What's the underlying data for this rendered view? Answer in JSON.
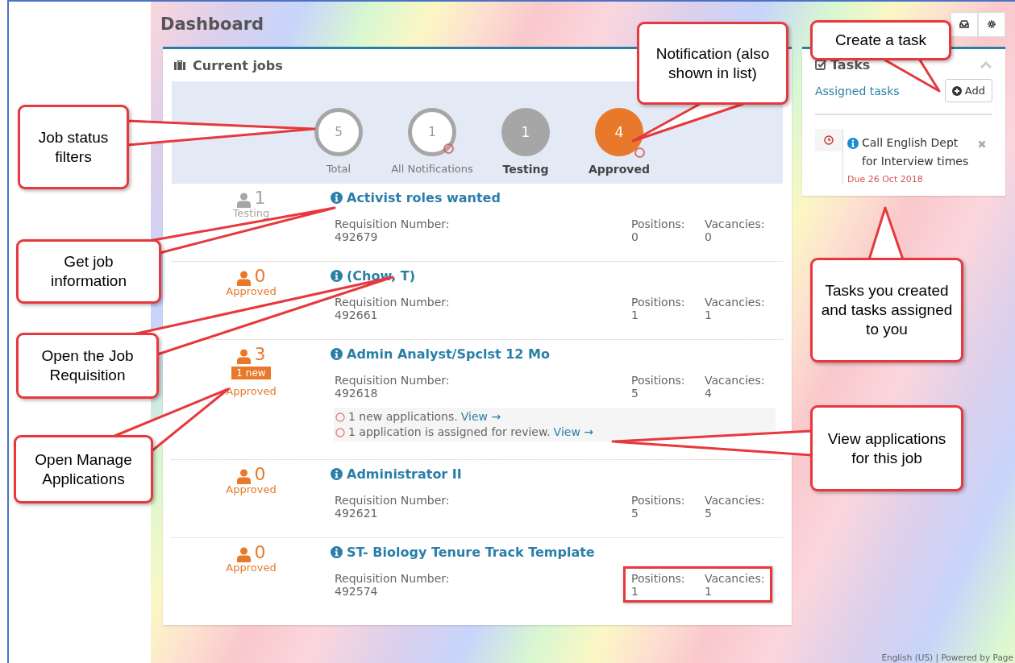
{
  "header": {
    "title": "Dashboard"
  },
  "jobs_panel": {
    "title": "Current jobs",
    "filters": [
      {
        "count": "5",
        "label": "Total",
        "kind": "outline",
        "notification": false
      },
      {
        "count": "1",
        "label": "All Notifications",
        "kind": "outline",
        "notification": true
      },
      {
        "count": "1",
        "label": "Testing",
        "kind": "filled",
        "color": "#a6a6a6",
        "notification": false
      },
      {
        "count": "4",
        "label": "Approved",
        "kind": "filled",
        "color": "#e8792b",
        "notification": true
      }
    ],
    "jobs": [
      {
        "applicants": "1",
        "status": "Testing",
        "color": "#a6a6a6",
        "title": "Activist roles wanted",
        "req_label": "Requisition Number:",
        "req_number": "492679",
        "positions_label": "Positions:",
        "positions": "0",
        "vacancies_label": "Vacancies:",
        "vacancies": "0",
        "highlighted": false
      },
      {
        "applicants": "0",
        "status": "Approved",
        "color": "#e8792b",
        "title": "(Chow, T)",
        "req_label": "Requisition Number:",
        "req_number": "492661",
        "positions_label": "Positions:",
        "positions": "1",
        "vacancies_label": "Vacancies:",
        "vacancies": "1",
        "highlighted": false
      },
      {
        "applicants": "3",
        "badge": "1 new",
        "status": "Approved",
        "color": "#e8792b",
        "title": "Admin Analyst/Spclst 12 Mo",
        "req_label": "Requisition Number:",
        "req_number": "492618",
        "positions_label": "Positions:",
        "positions": "5",
        "vacancies_label": "Vacancies:",
        "vacancies": "4",
        "highlighted": false,
        "notes": [
          {
            "text": "1 new applications.",
            "link": "View →"
          },
          {
            "text": "1 application is assigned for review.",
            "link": "View →"
          }
        ]
      },
      {
        "applicants": "0",
        "status": "Approved",
        "color": "#e8792b",
        "title": "Administrator II",
        "req_label": "Requisition Number:",
        "req_number": "492621",
        "positions_label": "Positions:",
        "positions": "5",
        "vacancies_label": "Vacancies:",
        "vacancies": "5",
        "highlighted": false
      },
      {
        "applicants": "0",
        "status": "Approved",
        "color": "#e8792b",
        "title": "ST- Biology Tenure Track Template",
        "req_label": "Requisition Number:",
        "req_number": "492574",
        "positions_label": "Positions:",
        "positions": "1",
        "vacancies_label": "Vacancies:",
        "vacancies": "1",
        "highlighted": true
      }
    ]
  },
  "tasks_panel": {
    "title": "Tasks",
    "link": "Assigned tasks",
    "add_button": "Add",
    "items": [
      {
        "title": "Call English Dept for Interview times",
        "due": "Due 26 Oct 2018"
      }
    ]
  },
  "footer": "English (US) | Powered by Page",
  "callouts": [
    {
      "text": "Job status filters"
    },
    {
      "text": "Notification (also shown in list)"
    },
    {
      "text": "Create a task"
    },
    {
      "text": "Get job information"
    },
    {
      "text": "Open the Job Requisition"
    },
    {
      "text": "Open Manage Applications"
    },
    {
      "text": "Tasks you created and tasks assigned to you"
    },
    {
      "text": "View applications for this job"
    }
  ]
}
